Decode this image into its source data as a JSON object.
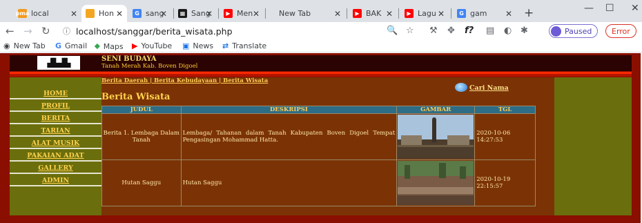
{
  "browser": {
    "tabs": [
      {
        "label": "local",
        "icon": "pma-icon",
        "color": "#f29b1d"
      },
      {
        "label": "Hon",
        "icon": "page-icon",
        "color": "#f4a623",
        "active": true
      },
      {
        "label": "sang",
        "icon": "google-icon",
        "color": "#4285f4"
      },
      {
        "label": "Sang",
        "icon": "grid-icon",
        "color": "#1a1a1a"
      },
      {
        "label": "Men",
        "icon": "youtube-icon",
        "color": "#ff0000"
      },
      {
        "label": "New Tab",
        "icon": "",
        "color": ""
      },
      {
        "label": "BAK",
        "icon": "youtube-icon",
        "color": "#ff0000"
      },
      {
        "label": "Lagu",
        "icon": "youtube-icon",
        "color": "#ff0000"
      },
      {
        "label": "gam",
        "icon": "google-icon",
        "color": "#4285f4"
      }
    ],
    "close_glyph": "✕",
    "newtab_glyph": "+",
    "url": "localhost/sanggar/berita_wisata.php",
    "profile_label": "Paused",
    "error_label": "Error",
    "bookmarks": [
      {
        "label": "New Tab",
        "icon": "globe-icon"
      },
      {
        "label": "Gmail",
        "icon": "google-icon"
      },
      {
        "label": "Maps",
        "icon": "maps-icon"
      },
      {
        "label": "YouTube",
        "icon": "youtube-icon"
      },
      {
        "label": "News",
        "icon": "news-icon"
      },
      {
        "label": "Translate",
        "icon": "translate-icon"
      }
    ]
  },
  "site": {
    "brand_title": "SENI BUDAYA",
    "brand_subtitle": "Tanah Merah Kab. Boven Digoel",
    "nav": [
      "HOME",
      "PROFIL",
      "BERITA",
      "TARIAN",
      "ALAT MUSIK",
      "PAKAIAN ADAT",
      "GALLERY",
      "ADMIN"
    ],
    "breadcrumb": "Berita Daerah | Berita Kebudayaan | Berita Wisata",
    "page_title": "Berita Wisata",
    "search_link": "Cari Nama",
    "table": {
      "headers": [
        "JUDUL",
        "DESKRIPSI",
        "GAMBAR",
        "TGL"
      ],
      "rows": [
        {
          "judul": "Berita 1. Lembaga Dalam Tanah",
          "deskripsi": "Lembaga/ Tahanan dalam Tanah Kabupaten Boven Digoel Tempat Pengasingan Mohammad Hatta.",
          "tgl": "2020-10-06 14:27:53"
        },
        {
          "judul": "Hutan Saggu",
          "deskripsi": "Hutan Saggu",
          "tgl": "2020-10-19 22:15:57"
        }
      ]
    }
  }
}
